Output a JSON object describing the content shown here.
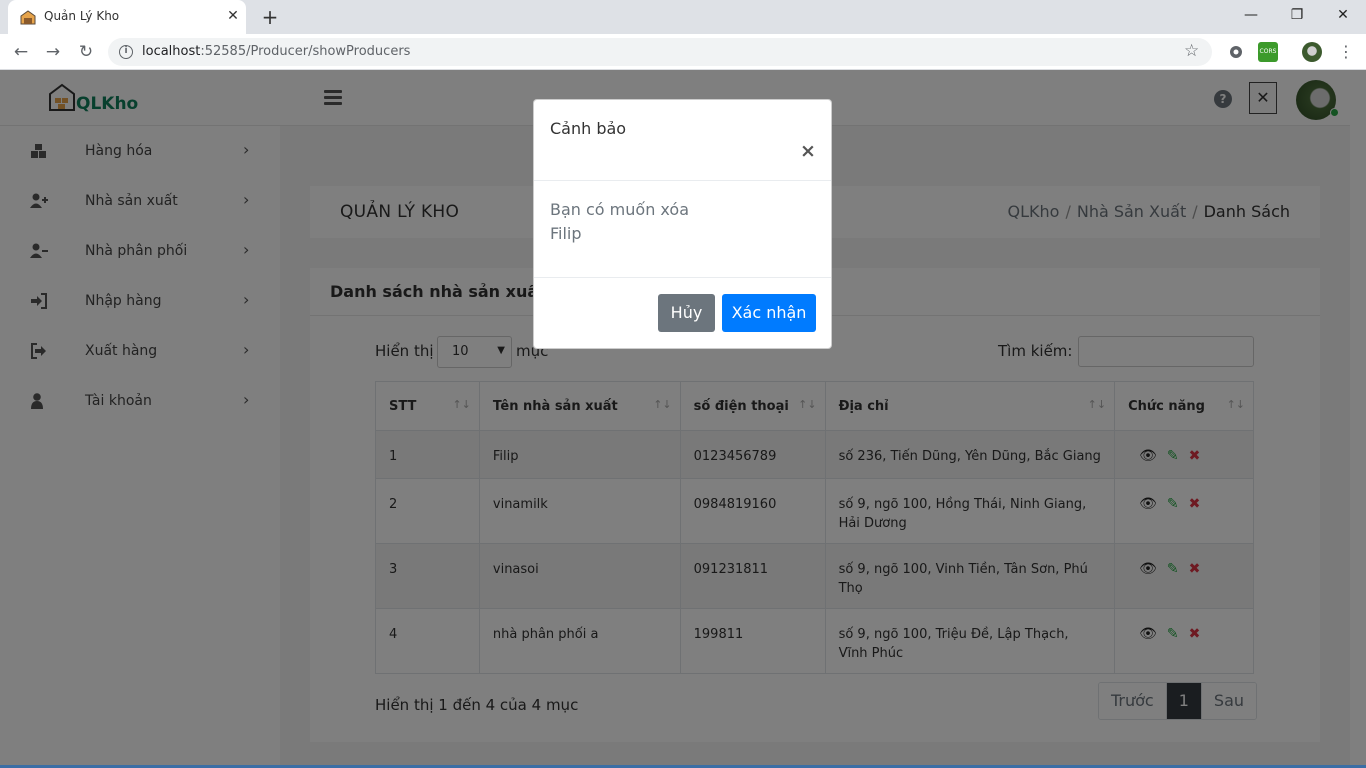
{
  "browser": {
    "tab_title": "Quản Lý Kho",
    "url_host": "localhost",
    "url_rest": ":52585/Producer/showProducers",
    "ext_cors_label": "CORS"
  },
  "header": {
    "logo_text": "QLKho"
  },
  "sidebar": {
    "items": [
      {
        "label": "Hàng hóa",
        "icon": "boxes-icon"
      },
      {
        "label": "Nhà sản xuất",
        "icon": "user-plus-icon"
      },
      {
        "label": "Nhà phân phối",
        "icon": "user-minus-icon"
      },
      {
        "label": "Nhập hàng",
        "icon": "sign-in-icon"
      },
      {
        "label": "Xuất hàng",
        "icon": "sign-out-icon"
      },
      {
        "label": "Tài khoản",
        "icon": "user-icon"
      }
    ]
  },
  "page": {
    "heading": "QUẢN LÝ KHO",
    "breadcrumb": [
      "QLKho",
      "Nhà Sản Xuất",
      "Danh Sách"
    ]
  },
  "list": {
    "title": "Danh sách nhà sản xuất",
    "length_label": "Hiển thị",
    "length_value": "10",
    "length_after": "mục",
    "search_label": "Tìm kiếm:",
    "search_value": "",
    "columns": [
      "STT",
      "Tên nhà sản xuất",
      "số điện thoại",
      "Địa chỉ",
      "Chức năng"
    ],
    "rows": [
      {
        "stt": "1",
        "name": "Filip",
        "phone": "0123456789",
        "address": "số 236, Tiến Dũng, Yên Dũng, Bắc Giang"
      },
      {
        "stt": "2",
        "name": "vinamilk",
        "phone": "0984819160",
        "address": "số 9, ngõ 100, Hồng Thái, Ninh Giang, Hải Dương"
      },
      {
        "stt": "3",
        "name": "vinasoi",
        "phone": "091231811",
        "address": "số 9, ngõ 100, Vinh Tiền, Tân Sơn, Phú Thọ"
      },
      {
        "stt": "4",
        "name": "nhà phân phối a",
        "phone": "199811",
        "address": "số 9, ngõ 100, Triệu Đề, Lập Thạch, Vĩnh Phúc"
      }
    ],
    "info": "Hiển thị 1 đến 4 của 4 mục",
    "pager": {
      "prev": "Trước",
      "current": "1",
      "next": "Sau"
    }
  },
  "modal": {
    "title": "Cảnh bảo",
    "body_line1": "Bạn có muốn xóa",
    "body_line2": "Filip",
    "cancel": "Hủy",
    "confirm": "Xác nhận"
  },
  "colors": {
    "primary": "#007bff",
    "secondary": "#6c757d",
    "danger": "#dc3545",
    "success": "#28a745",
    "logo": "#10805c"
  }
}
